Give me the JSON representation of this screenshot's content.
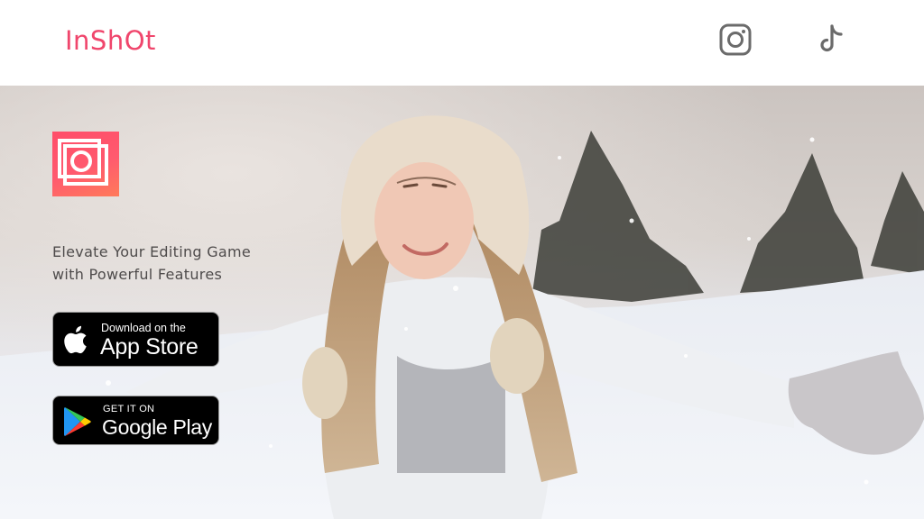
{
  "header": {
    "logo_text": "InShOt",
    "social": [
      {
        "icon": "instagram-icon"
      },
      {
        "icon": "tiktok-icon"
      }
    ]
  },
  "hero": {
    "app_icon": "inshot-app-icon",
    "tagline_line1": "Elevate Your Editing Game",
    "tagline_line2": "with Powerful Features",
    "app_store": {
      "small": "Download on the",
      "big": "App Store",
      "icon": "apple-icon"
    },
    "google_play": {
      "small": "GET IT ON",
      "big": "Google Play",
      "icon": "google-play-icon"
    }
  },
  "colors": {
    "brand": "#f0466c",
    "tagline": "#4e4b4b",
    "button_bg": "#000000"
  }
}
